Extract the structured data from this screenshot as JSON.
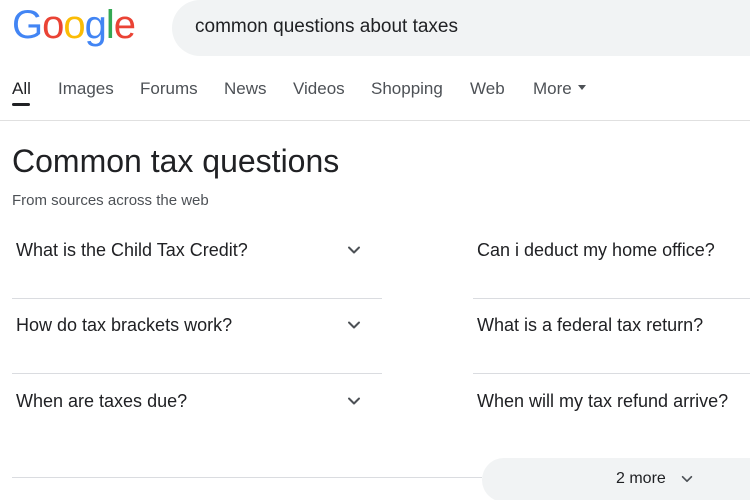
{
  "logo": {
    "letters": [
      "G",
      "o",
      "o",
      "g",
      "l",
      "e"
    ],
    "colors": [
      "#4285F4",
      "#EA4335",
      "#FBBC05",
      "#4285F4",
      "#34A853",
      "#EA4335"
    ]
  },
  "search": {
    "query": "common questions about taxes"
  },
  "tabs": [
    {
      "label": "All"
    },
    {
      "label": "Images"
    },
    {
      "label": "Forums"
    },
    {
      "label": "News"
    },
    {
      "label": "Videos"
    },
    {
      "label": "Shopping"
    },
    {
      "label": "Web"
    },
    {
      "label": "More"
    }
  ],
  "section": {
    "title": "Common tax questions",
    "subtitle": "From sources across the web"
  },
  "questions": {
    "left": [
      "What is the Child Tax Credit?",
      "How do tax brackets work?",
      "When are taxes due?"
    ],
    "right": [
      "Can i deduct my home office?",
      "What is a federal tax return?",
      "When will my tax refund arrive?"
    ]
  },
  "more_button": {
    "label": "2 more"
  }
}
